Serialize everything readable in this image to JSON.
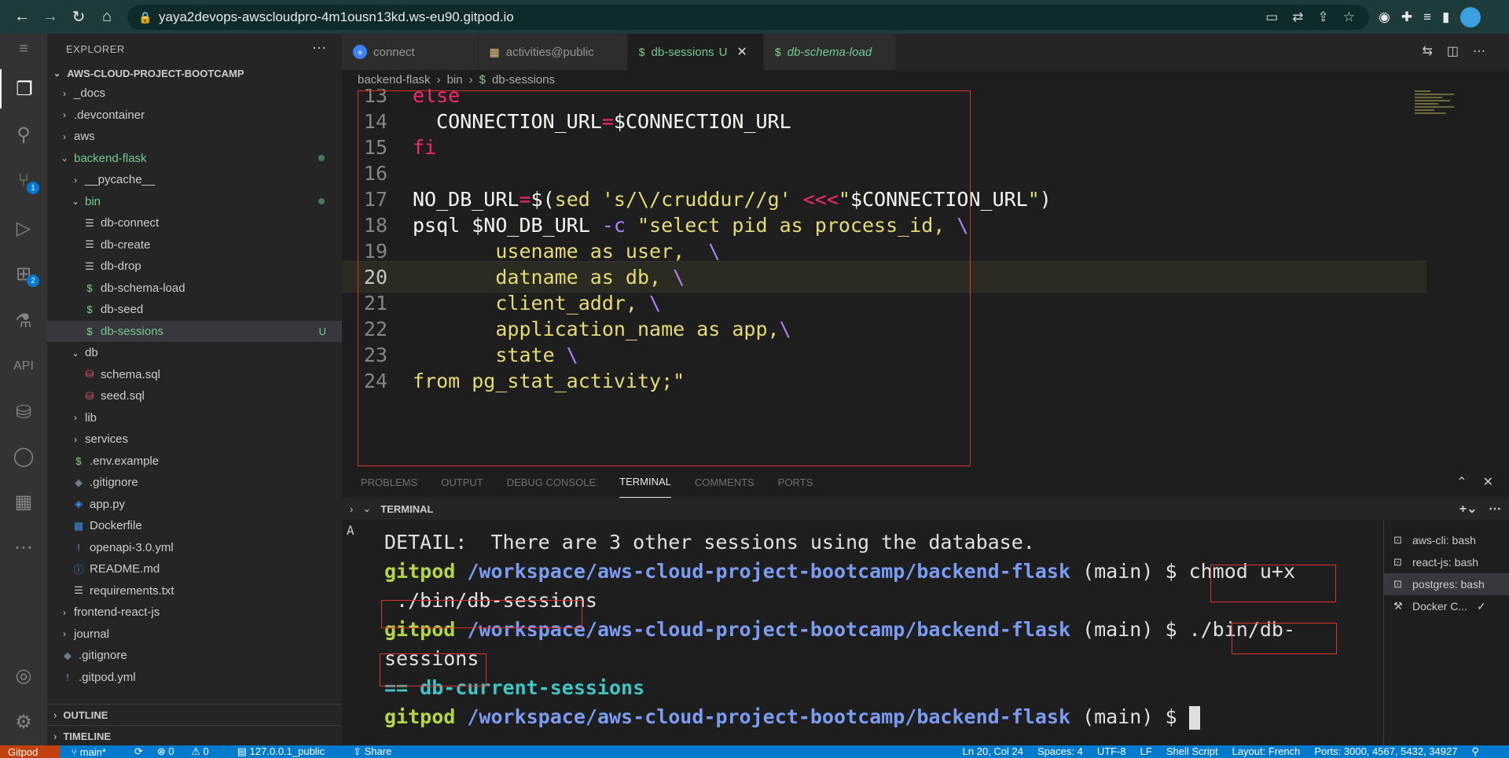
{
  "browser": {
    "url": "yaya2devops-awscloudpro-4m1ousn13kd.ws-eu90.gitpod.io"
  },
  "explorer": {
    "title": "EXPLORER",
    "root": "AWS-CLOUD-PROJECT-BOOTCAMP",
    "items": [
      {
        "label": "_docs",
        "indent": 0,
        "type": "folder-closed"
      },
      {
        "label": ".devcontainer",
        "indent": 0,
        "type": "folder-closed"
      },
      {
        "label": "aws",
        "indent": 0,
        "type": "folder-closed"
      },
      {
        "label": "backend-flask",
        "indent": 0,
        "type": "folder-open",
        "modified": true
      },
      {
        "label": "__pycache__",
        "indent": 1,
        "type": "folder-closed"
      },
      {
        "label": "bin",
        "indent": 1,
        "type": "folder-open",
        "modified": true
      },
      {
        "label": "db-connect",
        "indent": 2,
        "type": "file"
      },
      {
        "label": "db-create",
        "indent": 2,
        "type": "file"
      },
      {
        "label": "db-drop",
        "indent": 2,
        "type": "file"
      },
      {
        "label": "db-schema-load",
        "indent": 2,
        "type": "shell"
      },
      {
        "label": "db-seed",
        "indent": 2,
        "type": "shell"
      },
      {
        "label": "db-sessions",
        "indent": 2,
        "type": "shell",
        "selected": true,
        "status": "U"
      },
      {
        "label": "db",
        "indent": 1,
        "type": "folder-open"
      },
      {
        "label": "schema.sql",
        "indent": 2,
        "type": "sql"
      },
      {
        "label": "seed.sql",
        "indent": 2,
        "type": "sql"
      },
      {
        "label": "lib",
        "indent": 1,
        "type": "folder-closed"
      },
      {
        "label": "services",
        "indent": 1,
        "type": "folder-closed"
      },
      {
        "label": ".env.example",
        "indent": 1,
        "type": "shell"
      },
      {
        "label": ".gitignore",
        "indent": 1,
        "type": "git"
      },
      {
        "label": "app.py",
        "indent": 1,
        "type": "python"
      },
      {
        "label": "Dockerfile",
        "indent": 1,
        "type": "docker"
      },
      {
        "label": "openapi-3.0.yml",
        "indent": 1,
        "type": "yaml"
      },
      {
        "label": "README.md",
        "indent": 1,
        "type": "info"
      },
      {
        "label": "requirements.txt",
        "indent": 1,
        "type": "file"
      },
      {
        "label": "frontend-react-js",
        "indent": 0,
        "type": "folder-closed"
      },
      {
        "label": "journal",
        "indent": 0,
        "type": "folder-closed"
      },
      {
        "label": ".gitignore",
        "indent": 0,
        "type": "git"
      },
      {
        "label": ".gitpod.yml",
        "indent": 0,
        "type": "yaml"
      }
    ],
    "outline": "OUTLINE",
    "timeline": "TIMELINE"
  },
  "tabs": [
    {
      "label": "connect",
      "icon": "plus-circle-icon",
      "active": false
    },
    {
      "label": "activities@public",
      "icon": "table-icon",
      "active": false
    },
    {
      "label": "db-sessions",
      "status": "U",
      "icon": "dollar-icon",
      "active": true
    },
    {
      "label": "db-schema-load",
      "icon": "dollar-icon",
      "active": false,
      "italic": true
    }
  ],
  "breadcrumb": [
    "backend-flask",
    "bin",
    "db-sessions"
  ],
  "editor": {
    "current_line": 20,
    "lines": [
      {
        "n": "13",
        "html": "<span class='kw'>else</span>"
      },
      {
        "n": "14",
        "html": "  CONNECTION_URL<span class='op'>=</span>$CONNECTION_URL"
      },
      {
        "n": "15",
        "html": "<span class='kw'>fi</span>"
      },
      {
        "n": "16",
        "html": ""
      },
      {
        "n": "17",
        "html": "NO_DB_URL<span class='op'>=</span>$(<span class='str'>sed 's/\\/cruddur//g'</span> <span class='op'>&lt;&lt;&lt;</span><span class='str'>\"</span>$CONNECTION_URL<span class='str'>\"</span>)"
      },
      {
        "n": "18",
        "html": "psql $NO_DB_URL <span class='pur'>-c</span> <span class='str'>\"select pid as process_id, </span><span class='pur'>\\</span>"
      },
      {
        "n": "19",
        "html": "       <span class='str'>usename as user,  </span><span class='pur'>\\</span>"
      },
      {
        "n": "20",
        "html": "       <span class='str'>datname as db, </span><span class='pur'>\\</span>"
      },
      {
        "n": "21",
        "html": "       <span class='str'>client_addr, </span><span class='pur'>\\</span>"
      },
      {
        "n": "22",
        "html": "       <span class='str'>application_name as app,</span><span class='pur'>\\</span>"
      },
      {
        "n": "23",
        "html": "       <span class='str'>state </span><span class='pur'>\\</span>"
      },
      {
        "n": "24",
        "html": "<span class='str'>from pg_stat_activity;\"</span>"
      }
    ]
  },
  "panel": {
    "tabs": [
      "PROBLEMS",
      "OUTPUT",
      "DEBUG CONSOLE",
      "TERMINAL",
      "COMMENTS",
      "PORTS"
    ],
    "active": "TERMINAL",
    "section": "TERMINAL"
  },
  "terminal": {
    "detail": "DETAIL:  There are 3 other sessions using the database.",
    "user": "gitpod",
    "path": "/workspace/aws-cloud-project-bootcamp/backend-flask",
    "branch": "(main)",
    "prompt": "$",
    "cmd1_a": "chmod u+x",
    "cmd1_b": " ./bin/db-sessions",
    "cmd2_a": "./bin/db-",
    "cmd2_b": "sessions",
    "output": "== db-current-sessions"
  },
  "terminal_list": [
    {
      "label": "aws-cli: bash",
      "selected": false
    },
    {
      "label": "react-js: bash",
      "selected": false
    },
    {
      "label": "postgres: bash",
      "selected": true
    },
    {
      "label": "Docker C...",
      "selected": false
    }
  ],
  "status": {
    "gitpod": "Gitpod",
    "branch": "main*",
    "problems": "0",
    "warnings": "0",
    "db": "127.0.0.1_public",
    "share": "Share",
    "position": "Ln 20, Col 24",
    "spaces": "Spaces: 4",
    "encoding": "UTF-8",
    "eol": "LF",
    "language": "Shell Script",
    "layout": "Layout: French",
    "ports": "Ports: 3000, 4567, 5432, 34927"
  }
}
